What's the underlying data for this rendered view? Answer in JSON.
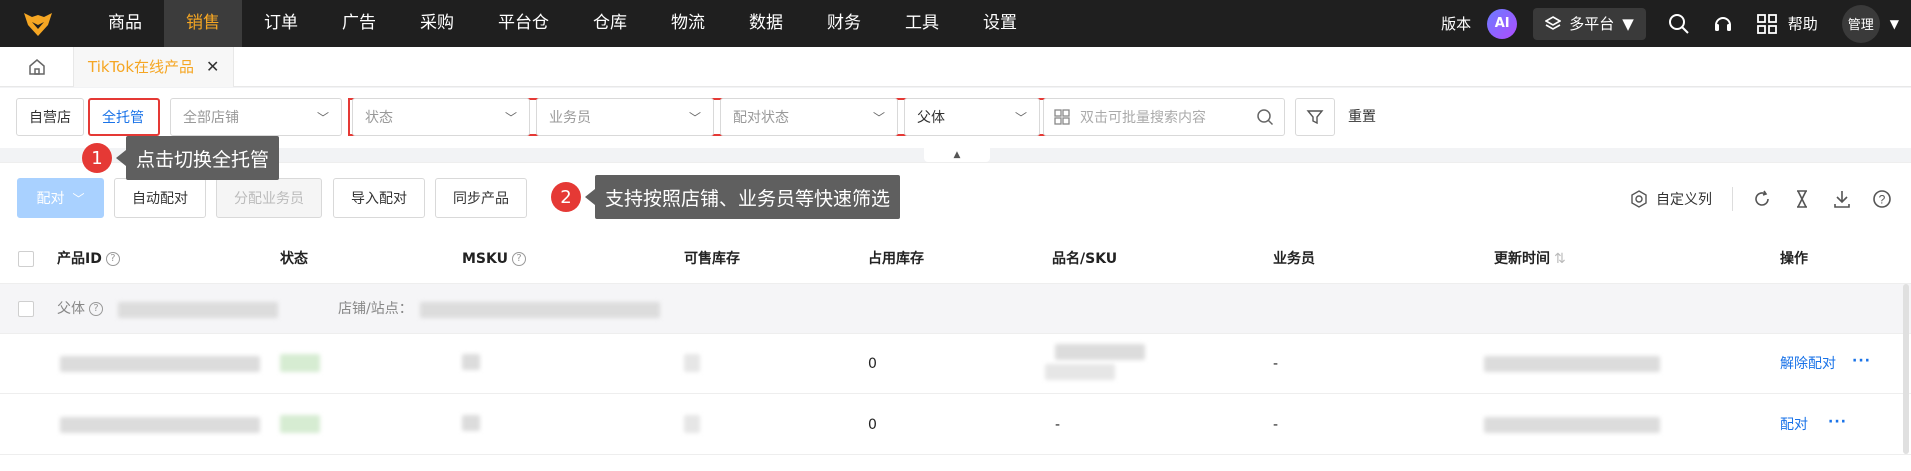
{
  "nav": {
    "items": [
      "商品",
      "销售",
      "订单",
      "广告",
      "采购",
      "平台仓",
      "仓库",
      "物流",
      "数据",
      "财务",
      "工具",
      "设置"
    ],
    "active_index": 1,
    "version_label": "版本",
    "ai_label": "AI",
    "platform_label": "多平台",
    "help_label": "帮助",
    "admin_label": "管理"
  },
  "tabs": {
    "current_tab": "TikTok在线产品"
  },
  "filters": {
    "seg_self": "自营店",
    "seg_full": "全托管",
    "store_placeholder": "全部店铺",
    "status_placeholder": "状态",
    "salesperson_placeholder": "业务员",
    "match_status_placeholder": "配对状态",
    "parent_value": "父体",
    "search_placeholder": "双击可批量搜索内容",
    "reset_label": "重置"
  },
  "toolbar": {
    "match_label": "配对",
    "auto_match_label": "自动配对",
    "assign_sales_label": "分配业务员",
    "import_match_label": "导入配对",
    "sync_label": "同步产品",
    "custom_columns_label": "自定义列"
  },
  "callouts": [
    {
      "num": "1",
      "text": "点击切换全托管"
    },
    {
      "num": "2",
      "text": "支持按照店铺、业务员等快速筛选"
    }
  ],
  "table": {
    "headers": [
      "产品ID",
      "状态",
      "MSKU",
      "可售库存",
      "占用库存",
      "品名/SKU",
      "业务员",
      "更新时间",
      "操作"
    ],
    "group": {
      "parent_label": "父体",
      "store_label": "店铺/站点："
    },
    "rows": [
      {
        "occupied": "0",
        "sku": "",
        "salesperson": "-",
        "action": "解除配对",
        "more": "···"
      },
      {
        "occupied": "0",
        "sku": "-",
        "salesperson": "-",
        "action": "配对",
        "more": "···"
      }
    ]
  },
  "colors": {
    "nav_bg": "#1f1f1f",
    "accent_orange": "#f5a623",
    "link_blue": "#1a73e8",
    "highlight_red": "#e53935"
  }
}
